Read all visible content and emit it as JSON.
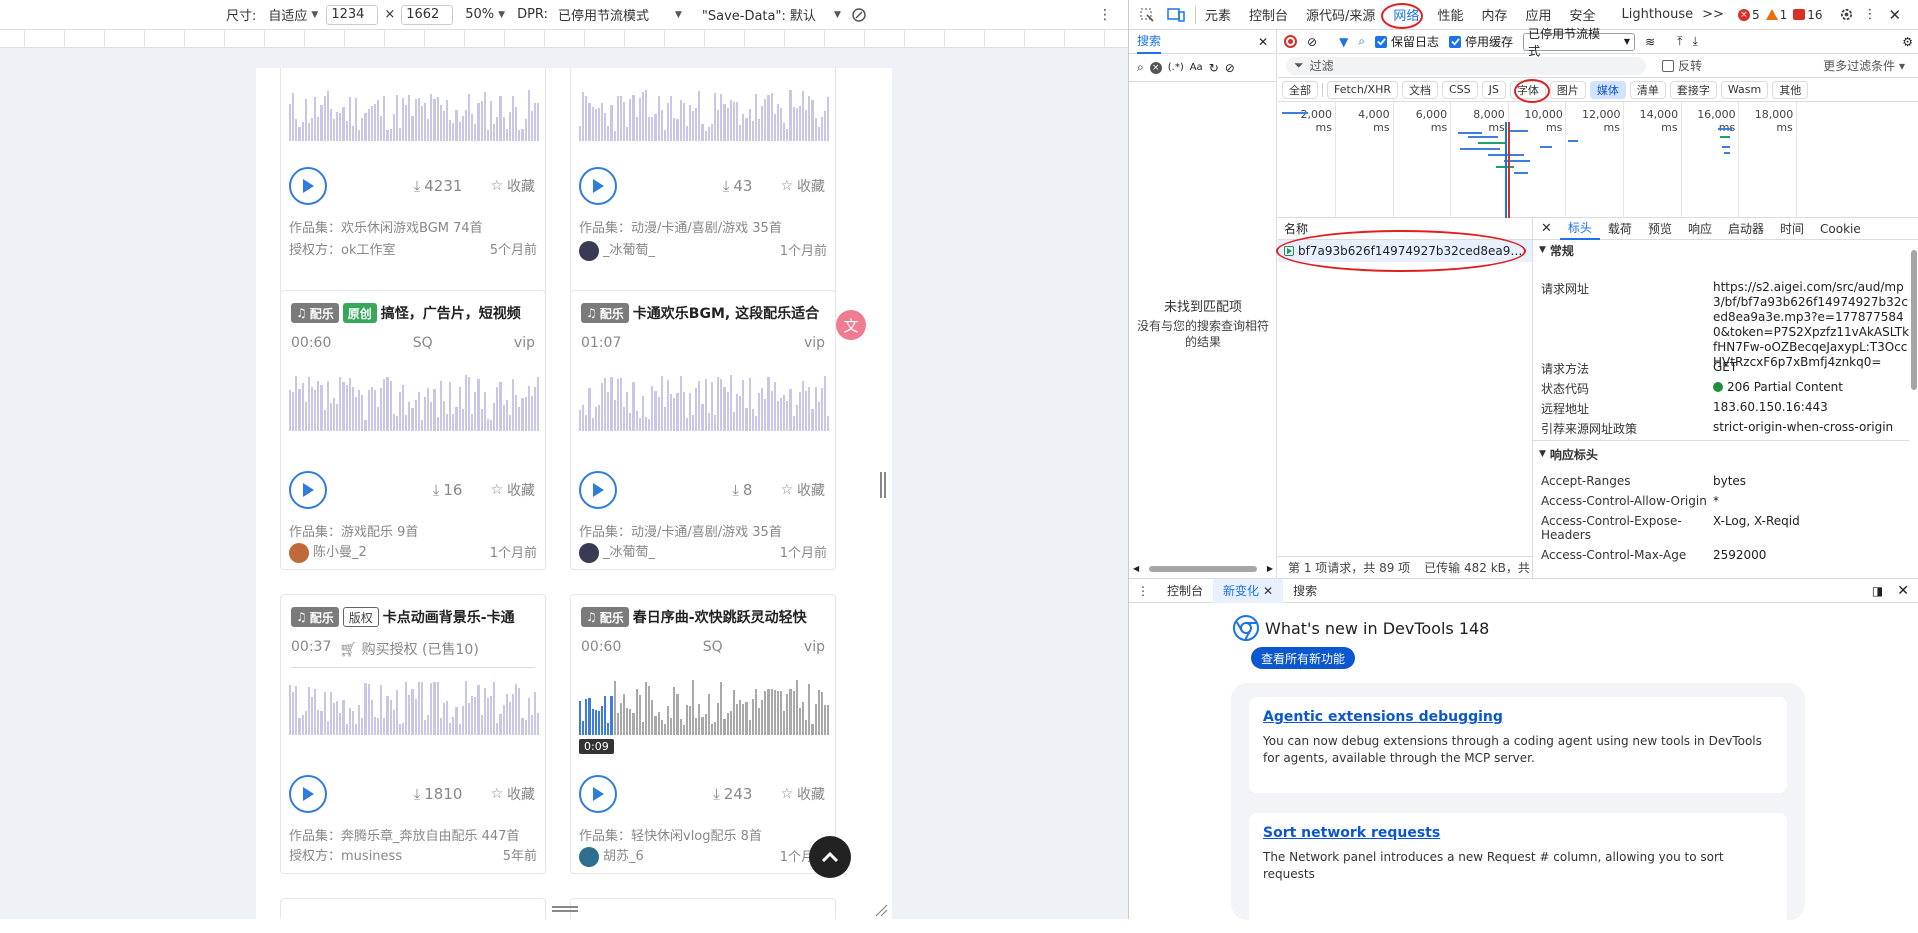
{
  "device_bar": {
    "size_label": "尺寸:",
    "device": "自适应",
    "width": "1234",
    "times": "×",
    "height": "1662",
    "zoom": "50%",
    "dpr_label": "DPR:",
    "dpr_value": "已停用节流模式",
    "save_data": "\"Save-Data\": 默认"
  },
  "cards": [
    {
      "downloads": "4231",
      "fav": "收藏",
      "collection": "作品集：欢乐休闲游戏BGM 74首",
      "author_prefix": "授权方：",
      "author": "ok工作室",
      "time": "5个月前"
    },
    {
      "downloads": "43",
      "fav": "收藏",
      "collection": "作品集：动漫/卡通/喜剧/游戏 35首",
      "author_prefix": "",
      "author": "_冰葡萄_",
      "time": "1个月前"
    },
    {
      "badges": [
        "配乐",
        "原创"
      ],
      "title": "搞怪，广告片，短视频",
      "duration": "00:60",
      "quality": "SQ",
      "tier": "vip",
      "downloads": "16",
      "fav": "收藏",
      "collection": "作品集：游戏配乐 9首",
      "author_prefix": "",
      "author": "陈小曼_2",
      "time": "1个月前"
    },
    {
      "badges": [
        "配乐"
      ],
      "title": "卡通欢乐BGM, 这段配乐适合",
      "duration": "01:07",
      "quality": "",
      "tier": "vip",
      "downloads": "8",
      "fav": "收藏",
      "collection": "作品集：动漫/卡通/喜剧/游戏 35首",
      "author_prefix": "",
      "author": "_冰葡萄_",
      "time": "1个月前"
    },
    {
      "badges": [
        "配乐",
        "版权"
      ],
      "title": "卡点动画背景乐-卡通",
      "duration": "00:37",
      "purchase": "购买授权 (已售10)",
      "downloads": "1810",
      "fav": "收藏",
      "collection": "作品集：奔腾乐章_奔放自由配乐 447首",
      "author_prefix": "授权方：",
      "author": "musiness",
      "time": "5年前"
    },
    {
      "badges": [
        "配乐"
      ],
      "title": "春日序曲-欢快跳跃灵动轻快",
      "duration": "00:60",
      "quality": "SQ",
      "tier": "vip",
      "downloads": "243",
      "fav": "收藏",
      "collection": "作品集：轻快休闲vlog配乐 8首",
      "author_prefix": "",
      "author": "胡苏_6",
      "time": "1个月前",
      "play_time": "0:09",
      "progress": 0.13
    }
  ],
  "devtools": {
    "tabs": [
      "元素",
      "控制台",
      "源代码/来源",
      "网络",
      "性能",
      "内存",
      "应用",
      "安全",
      "Lighthouse"
    ],
    "active_tab": "网络",
    "more": ">>",
    "errors": "5",
    "warnings": "1",
    "issues": "16",
    "search_panel": {
      "title": "搜索",
      "regex": "(.*)",
      "case": "Aa",
      "empty_title": "未找到匹配项",
      "empty_desc": "没有与您的搜索查询相符的结果"
    },
    "toolbar": {
      "preserve_log": "保留日志",
      "disable_cache": "停用缓存",
      "throttle": "已停用节流模式"
    },
    "filter": {
      "placeholder": "过滤",
      "invert": "反转",
      "more": "更多过滤条件"
    },
    "types": [
      "全部",
      "Fetch/XHR",
      "文档",
      "CSS",
      "JS",
      "字体",
      "图片",
      "媒体",
      "清单",
      "套接字",
      "Wasm",
      "其他"
    ],
    "active_type": "媒体",
    "timeline_labels": [
      "2,000 ms",
      "4,000 ms",
      "6,000 ms",
      "8,000 ms",
      "10,000 ms",
      "12,000 ms",
      "14,000 ms",
      "16,000 ms",
      "18,000 ms"
    ],
    "name_header": "名称",
    "request_name": "bf7a93b626f14974927b32ced8ea9a3e.mp3",
    "status_bar": "第 1 项请求，共 89 项",
    "transferred": "已传输 482 kB，共",
    "detail_tabs": [
      "标头",
      "载荷",
      "预览",
      "响应",
      "启动器",
      "时间",
      "Cookie"
    ],
    "active_detail_tab": "标头",
    "general_title": "常规",
    "general": [
      {
        "k": "请求网址",
        "v": "https://s2.aigei.com/src/aud/mp3/bf/bf7a93b626f14974927b32ced8ea9a3e.mp3?e=1778775840&token=P7S2Xpzfz11vAkASLTkfHN7Fw-oOZBecqeJaxypL:T3OccHVtRzcxF6p7xBmfj4znkq0="
      },
      {
        "k": "请求方法",
        "v": "GET"
      },
      {
        "k": "状态代码",
        "v": "206 Partial Content"
      },
      {
        "k": "远程地址",
        "v": "183.60.150.16:443"
      },
      {
        "k": "引荐来源网址政策",
        "v": "strict-origin-when-cross-origin"
      }
    ],
    "response_title": "响应标头",
    "response": [
      {
        "k": "Accept-Ranges",
        "v": "bytes"
      },
      {
        "k": "Access-Control-Allow-Origin",
        "v": "*"
      },
      {
        "k": "Access-Control-Expose-Headers",
        "v": "X-Log, X-Reqid"
      },
      {
        "k": "Access-Control-Max-Age",
        "v": "2592000"
      }
    ],
    "drawer": {
      "tabs": [
        "控制台",
        "新变化",
        "搜索"
      ],
      "active": "新变化",
      "title": "What's new in DevTools 148",
      "all_button": "查看所有新功能",
      "features": [
        {
          "title": "Agentic extensions debugging",
          "desc": "You can now debug extensions through a coding agent using new tools in DevTools for agents, available through the MCP server."
        },
        {
          "title": "Sort network requests",
          "desc": "The Network panel introduces a new Request # column, allowing you to sort requests"
        }
      ]
    }
  },
  "colors": {
    "accent": "#1a73e8",
    "play": "#2f7be0",
    "highlight_ring": "#e02020",
    "wave": "#c9c6e8"
  }
}
